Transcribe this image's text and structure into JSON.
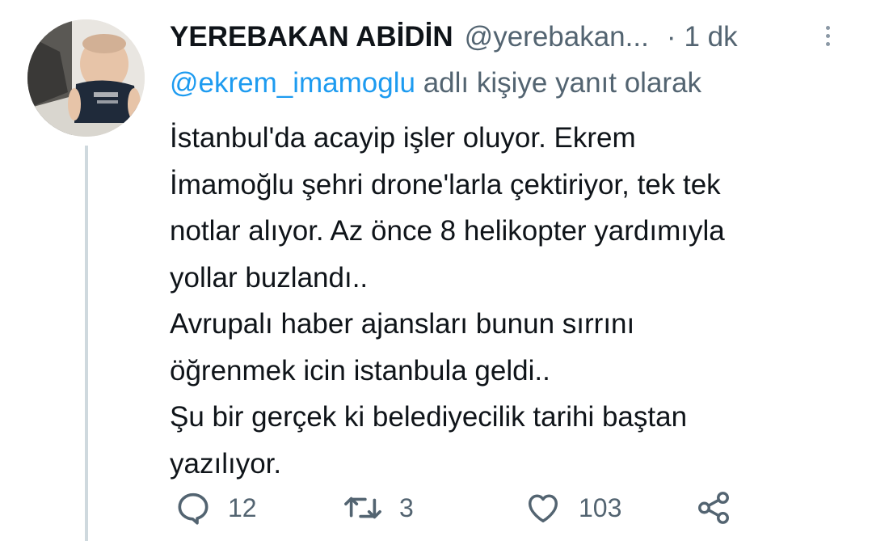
{
  "tweet": {
    "display_name": "YEREBAKAN ABİDİN",
    "handle": "@yerebakan...",
    "separator": "·",
    "time": "1 dk",
    "reply_to": {
      "mention": "@ekrem_imamoglu",
      "suffix": "adlı kişiye yanıt olarak"
    },
    "text_lines": [
      "İstanbul'da acayip işler oluyor. Ekrem",
      "İmamoğlu şehri  drone'larla çektiriyor, tek tek",
      "notlar alıyor. Az önce 8 helikopter yardımıyla",
      "yollar buzlandı..",
      "Avrupalı haber ajansları bunun sırrını",
      "öğrenmek icin istanbula geldi..",
      "Şu bir gerçek ki belediyecilik tarihi baştan",
      "yazılıyor."
    ],
    "actions": {
      "reply": {
        "icon": "reply-icon",
        "count": "12"
      },
      "retweet": {
        "icon": "retweet-icon",
        "count": "3"
      },
      "like": {
        "icon": "heart-icon",
        "count": "103"
      },
      "share": {
        "icon": "share-icon"
      }
    }
  },
  "colors": {
    "primary_text": "#0f1419",
    "secondary_text": "#536471",
    "link": "#1d9bf0",
    "thread_line": "#cfd9de"
  }
}
